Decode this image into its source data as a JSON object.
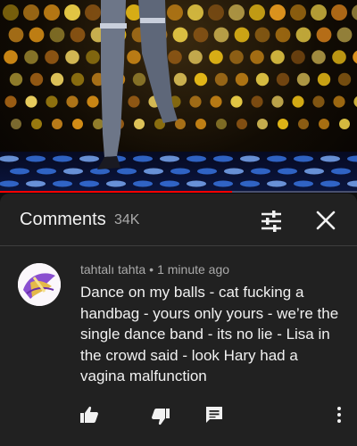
{
  "colors": {
    "background": "#0f0f0f",
    "panel": "#212121",
    "primary_text": "#f1f1f1",
    "secondary_text": "#aaaaaa",
    "progress": "#ff0000"
  },
  "video": {
    "progress_fraction": 0.65
  },
  "comments_panel": {
    "title": "Comments",
    "count": "34K",
    "icons": [
      "filter-icon",
      "close-icon"
    ]
  },
  "comment": {
    "author": "tahtalı tahta",
    "separator": "•",
    "time": "1 minute ago",
    "text": "Dance on my balls - cat fucking a handbag - yours only yours - we’re the single dance band - its no lie - Lisa in the crowd said - look Hary had a vagina malfunction",
    "actions": [
      "thumbs-up-icon",
      "thumbs-down-icon",
      "reply-icon",
      "more-vert-icon"
    ]
  }
}
